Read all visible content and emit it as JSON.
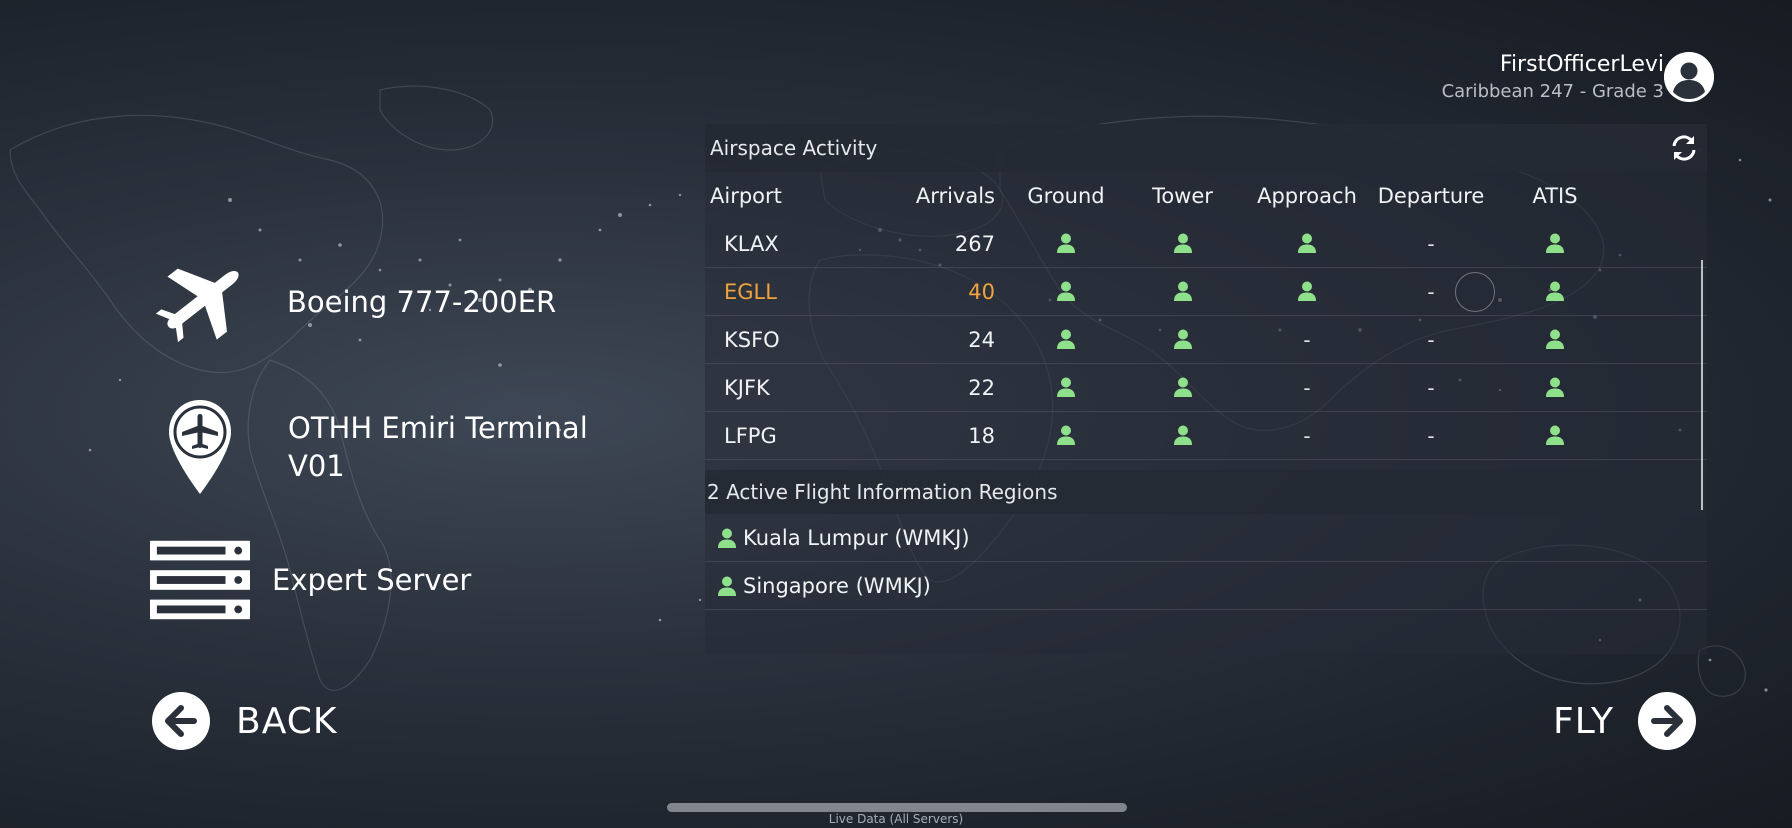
{
  "profile": {
    "username": "FirstOfficerLevi",
    "subtitle": "Caribbean 247 - Grade 3",
    "avatar_icon": "user-avatar-icon"
  },
  "selection": {
    "aircraft": "Boeing 777-200ER",
    "location_line1": "OTHH Emiri Terminal",
    "location_line2": "V01",
    "server": "Expert Server"
  },
  "nav": {
    "back_label": "BACK",
    "fly_label": "FLY"
  },
  "airspace": {
    "title": "Airspace Activity",
    "columns": [
      "Airport",
      "Arrivals",
      "Ground",
      "Tower",
      "Approach",
      "Departure",
      "ATIS"
    ],
    "rows": [
      {
        "airport": "KLAX",
        "arrivals": "267",
        "ground": true,
        "tower": true,
        "approach": true,
        "departure": false,
        "atis": true,
        "highlight": false
      },
      {
        "airport": "EGLL",
        "arrivals": "40",
        "ground": true,
        "tower": true,
        "approach": true,
        "departure": false,
        "atis": true,
        "highlight": true
      },
      {
        "airport": "KSFO",
        "arrivals": "24",
        "ground": true,
        "tower": true,
        "approach": false,
        "departure": false,
        "atis": true,
        "highlight": false
      },
      {
        "airport": "KJFK",
        "arrivals": "22",
        "ground": true,
        "tower": true,
        "approach": false,
        "departure": false,
        "atis": true,
        "highlight": false
      },
      {
        "airport": "LFPG",
        "arrivals": "18",
        "ground": true,
        "tower": true,
        "approach": false,
        "departure": false,
        "atis": true,
        "highlight": false
      }
    ],
    "empty_symbol": "-"
  },
  "fir": {
    "title": "2 Active Flight Information Regions",
    "regions": [
      {
        "name": "Kuala Lumpur (WMKJ)"
      },
      {
        "name": "Singapore (WMKJ)"
      }
    ]
  },
  "footer": {
    "caption": "Live Data (All Servers)"
  },
  "colors": {
    "active_controller": "#8fe08a",
    "highlight_airport": "#f0a33c",
    "panel_bg": "#262c36"
  }
}
